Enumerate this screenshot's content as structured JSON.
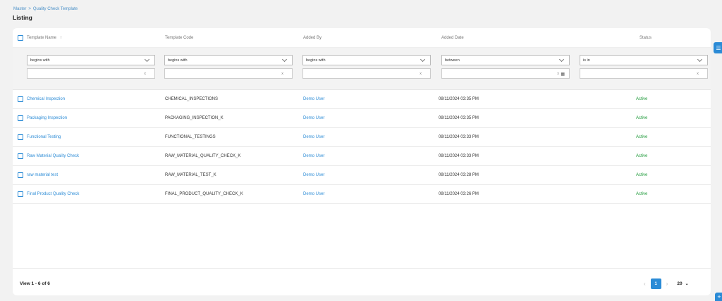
{
  "breadcrumb": {
    "root": "Master",
    "separator": ">",
    "current": "Quality Check Template"
  },
  "page_title": "Listing",
  "columns": [
    {
      "label": "Template Name",
      "sort": "↑"
    },
    {
      "label": "Template Code"
    },
    {
      "label": "Added By"
    },
    {
      "label": "Added Date"
    },
    {
      "label": "Status"
    }
  ],
  "filters": [
    {
      "operator": "begins with",
      "value": "",
      "clear": "x"
    },
    {
      "operator": "begins with",
      "value": "",
      "clear": "x"
    },
    {
      "operator": "begins with",
      "value": "",
      "clear": "x"
    },
    {
      "operator": "between",
      "value": "",
      "clear": "x",
      "icon": "calendar-icon"
    },
    {
      "operator": "is in",
      "value": "",
      "clear": "x"
    }
  ],
  "rows": [
    {
      "name": "Chemical Inspection",
      "code": "CHEMICAL_INSPECTIONS",
      "added_by": "Demo User",
      "added_date": "08/11/2024 03:35 PM",
      "status": "Active"
    },
    {
      "name": "Packaging Inspection",
      "code": "PACKAGING_INSPECTION_K",
      "added_by": "Demo User",
      "added_date": "08/11/2024 03:35 PM",
      "status": "Active"
    },
    {
      "name": "Functional Testing",
      "code": "FUNCTIONAL_TESTINGS",
      "added_by": "Demo User",
      "added_date": "08/11/2024 03:33 PM",
      "status": "Active"
    },
    {
      "name": "Raw Material Quality Check",
      "code": "RAW_MATERIAL_QUALITY_CHECK_K",
      "added_by": "Demo User",
      "added_date": "08/11/2024 03:33 PM",
      "status": "Active"
    },
    {
      "name": "raw material test",
      "code": "RAW_MATERIAL_TEST_K",
      "added_by": "Demo User",
      "added_date": "08/11/2024 03:28 PM",
      "status": "Active"
    },
    {
      "name": "Final Product Quality Check",
      "code": "FINAL_PRODUCT_QUALITY_CHECK_K",
      "added_by": "Demo User",
      "added_date": "08/11/2024 03:26 PM",
      "status": "Active"
    }
  ],
  "pagination": {
    "summary": "View 1 - 6 of 6",
    "prev": "‹",
    "current_page": "1",
    "next": "›",
    "page_size": "20",
    "page_size_caret": "⌄"
  },
  "side_buttons": {
    "filter_icon": "sliders-icon",
    "add_label": "+"
  },
  "colors": {
    "accent": "#2b8bd6",
    "active": "#1f9a3a"
  }
}
